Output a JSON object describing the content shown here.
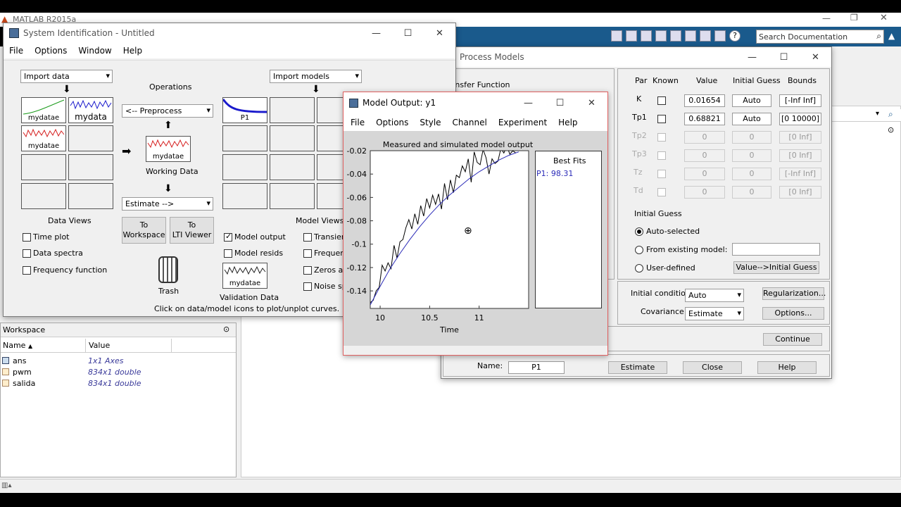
{
  "matlab": {
    "title": "MATLAB R2015a",
    "search_placeholder": "Search Documentation"
  },
  "sysid": {
    "title": "System Identification - Untitled",
    "menu": [
      "File",
      "Options",
      "Window",
      "Help"
    ],
    "import_data": "Import data",
    "import_models": "Import models",
    "operations": "Operations",
    "preprocess": "<-- Preprocess",
    "estimate": "Estimate -->",
    "working_data": "Working Data",
    "working_data_name": "mydatae",
    "data_views": "Data Views",
    "model_views": "Model Views",
    "data_icons": [
      "mydatae",
      "mydata",
      "mydatae"
    ],
    "model_icon": "P1",
    "to_workspace": [
      "To",
      "Workspace"
    ],
    "to_lti": [
      "To",
      "LTI Viewer"
    ],
    "trash": "Trash",
    "validation_data": "Validation Data",
    "validation_name": "mydatae",
    "data_checks": [
      "Time plot",
      "Data spectra",
      "Frequency function"
    ],
    "model_checks": [
      "Model output",
      "Model resids"
    ],
    "model_checks2": [
      "Transient",
      "Frequency",
      "Zeros and",
      "Noise sp"
    ],
    "hint": "Click on data/model icons to plot/unplot curves."
  },
  "workspace": {
    "title": "Workspace",
    "col_name": "Name",
    "col_value": "Value",
    "rows": [
      {
        "name": "ans",
        "value": "1x1 Axes"
      },
      {
        "name": "pwm",
        "value": "834x1 double"
      },
      {
        "name": "salida",
        "value": "834x1 double"
      }
    ]
  },
  "process": {
    "title": "Process Models",
    "tf_label": "Transfer Function",
    "headers": [
      "Par",
      "Known",
      "Value",
      "Initial Guess",
      "Bounds"
    ],
    "params": [
      {
        "name": "K",
        "value": "0.01654",
        "guess": "Auto",
        "bounds": "[-Inf Inf]",
        "enabled": true
      },
      {
        "name": "Tp1",
        "value": "0.68821",
        "guess": "Auto",
        "bounds": "[0 10000]",
        "enabled": true
      },
      {
        "name": "Tp2",
        "value": "0",
        "guess": "0",
        "bounds": "[0 Inf]",
        "enabled": false
      },
      {
        "name": "Tp3",
        "value": "0",
        "guess": "0",
        "bounds": "[0 Inf]",
        "enabled": false
      },
      {
        "name": "Tz",
        "value": "0",
        "guess": "0",
        "bounds": "[-Inf Inf]",
        "enabled": false
      },
      {
        "name": "Td",
        "value": "0",
        "guess": "0",
        "bounds": "[0 Inf]",
        "enabled": false
      }
    ],
    "initial_guess": "Initial Guess",
    "radio": [
      "Auto-selected",
      "From existing model:",
      "User-defined"
    ],
    "value_ig": "Value-->Initial Guess",
    "initial_condition": "Initial condition:",
    "ic_value": "Auto",
    "covariance": "Covariance:",
    "cov_value": "Estimate",
    "regularization": "Regularization...",
    "options": "Options...",
    "continue": "Continue",
    "name_label": "Name:",
    "name_value": "P1",
    "estimate": "Estimate",
    "close": "Close",
    "help": "Help"
  },
  "model_output": {
    "title": "Model Output: y1",
    "menu": [
      "File",
      "Options",
      "Style",
      "Channel",
      "Experiment",
      "Help"
    ],
    "best_fits": "Best Fits",
    "fit_entry": "P1: 98.31"
  },
  "chart_data": {
    "type": "line",
    "title": "Measured and simulated model output",
    "xlabel": "Time",
    "ylabel": "",
    "xlim": [
      9.9,
      11.5
    ],
    "ylim": [
      -0.155,
      -0.02
    ],
    "xticks": [
      10,
      10.5,
      11
    ],
    "yticks": [
      -0.02,
      -0.04,
      -0.06,
      -0.08,
      -0.1,
      -0.12,
      -0.14
    ],
    "series": [
      {
        "x": [
          9.9,
          9.93,
          9.96,
          9.99,
          10.02,
          10.05,
          10.08,
          10.11,
          10.14,
          10.17,
          10.2,
          10.23,
          10.26,
          10.29,
          10.32,
          10.35,
          10.38,
          10.41,
          10.44,
          10.47,
          10.5,
          10.53,
          10.56,
          10.59,
          10.62,
          10.65,
          10.68,
          10.71,
          10.74,
          10.77,
          10.8,
          10.83,
          10.86,
          10.89,
          10.92,
          10.95,
          10.98,
          11.01,
          11.04,
          11.07,
          11.1,
          11.13,
          11.16,
          11.19,
          11.22,
          11.25,
          11.28,
          11.31,
          11.34,
          11.37
        ],
        "y": [
          -0.15,
          -0.148,
          -0.14,
          -0.137,
          -0.118,
          -0.123,
          -0.116,
          -0.121,
          -0.101,
          -0.112,
          -0.098,
          -0.096,
          -0.086,
          -0.079,
          -0.087,
          -0.074,
          -0.083,
          -0.067,
          -0.076,
          -0.061,
          -0.069,
          -0.058,
          -0.066,
          -0.057,
          -0.07,
          -0.048,
          -0.062,
          -0.045,
          -0.056,
          -0.041,
          -0.043,
          -0.033,
          -0.038,
          -0.027,
          -0.047,
          -0.021,
          -0.03,
          -0.032,
          -0.019,
          -0.026,
          -0.04,
          -0.027,
          -0.031,
          -0.029,
          -0.018,
          -0.022,
          -0.016,
          -0.023,
          -0.02,
          -0.022
        ]
      },
      {
        "x": [
          9.9,
          10,
          10.1,
          10.2,
          10.3,
          10.4,
          10.5,
          10.6,
          10.7,
          10.8,
          10.9,
          11,
          11.1,
          11.2,
          11.3,
          11.4
        ],
        "y": [
          -0.152,
          -0.136,
          -0.121,
          -0.108,
          -0.096,
          -0.085,
          -0.075,
          -0.066,
          -0.058,
          -0.051,
          -0.044,
          -0.038,
          -0.033,
          -0.028,
          -0.024,
          -0.021
        ]
      }
    ]
  },
  "colors": {
    "measured": "#000000",
    "simulated": "#2b2bb8",
    "data_red": "#d62020",
    "data_blue": "#1a1acc",
    "data_green": "#1a9a1a",
    "toolbar_blue": "#1a5a8c"
  }
}
